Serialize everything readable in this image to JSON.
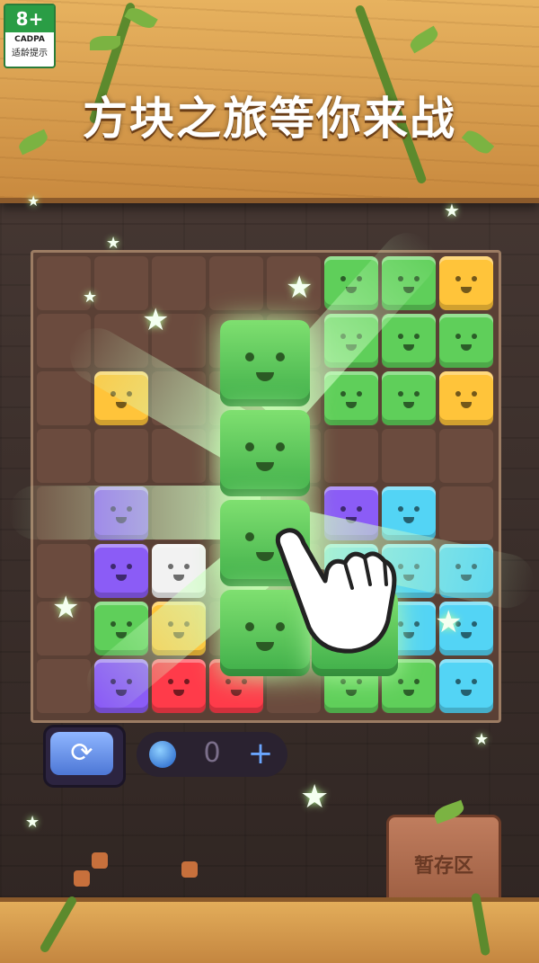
{
  "header": {
    "title": "方块之旅等你来战",
    "age_rating": {
      "number": "8+",
      "org": "CADPA",
      "text": "适龄提示"
    }
  },
  "controls": {
    "refresh_icon": "refresh-icon",
    "gem_count": "0",
    "add_label": "+"
  },
  "storage": {
    "label": "暂存区"
  },
  "colors": {
    "green": "#5fcf5a",
    "yellow": "#ffc43a",
    "red": "#ff3b4a",
    "purple": "#8b5cf6",
    "cyan": "#53d4f5",
    "board": "#5a4035",
    "wood": "#d79b4c"
  }
}
